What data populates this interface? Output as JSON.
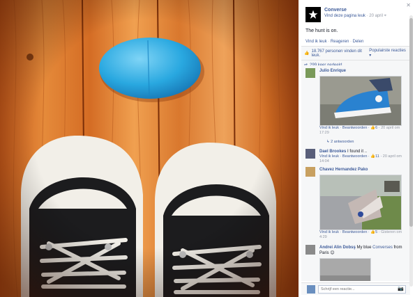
{
  "post": {
    "page_name": "Converse",
    "like_page": "Vind deze pagina leuk",
    "date": "20 april",
    "text": "The hunt is on.",
    "actions": [
      "Vind ik leuk",
      "Reageren",
      "Delen"
    ],
    "likes": "18.767 personen vinden dit leuk.",
    "popular_link": "Populairste reacties",
    "shares": "299 keer gedeeld"
  },
  "comments": [
    {
      "name": "Julio Enrique",
      "text": "",
      "like": "Vind ik leuk",
      "reply": "Beantwoorden",
      "likes_count": "6",
      "time": "20 april om 17:29",
      "replies": "2 antwoorden"
    },
    {
      "name": "Dael Brookes",
      "text": "I found it ..",
      "like": "Vind ik leuk",
      "reply": "Beantwoorden",
      "likes_count": "11",
      "time": "20 april om 14:04"
    },
    {
      "name": "Chavez Hernandez Pako",
      "text": "",
      "like": "Vind ik leuk",
      "reply": "Beantwoorden",
      "likes_count": "5",
      "time": "Gisteren om 4:29"
    },
    {
      "name": "Andrei Alin Dobsş",
      "text": "My blue",
      "text_link": "Converses",
      "text_end": "from Paris",
      "emoji": "😊"
    }
  ],
  "composer": {
    "placeholder": "Schrijf een reactie..."
  },
  "colors": {
    "brand_link": "#3b5998",
    "panel_bg": "#f6f7f8",
    "egg": "#29a8e0"
  },
  "icons": [
    "close-icon",
    "converse-star-icon",
    "globe-icon",
    "thumbs-up-icon",
    "share-icon",
    "camera-icon"
  ]
}
